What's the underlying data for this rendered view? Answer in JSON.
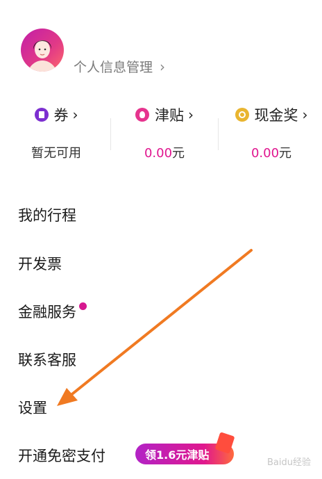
{
  "profile": {
    "link_label": "个人信息管理",
    "chevron": "›"
  },
  "wallet": [
    {
      "icon": "coupon-icon",
      "label": "券",
      "value_text": "暂无可用",
      "value_num": "",
      "value_unit": ""
    },
    {
      "icon": "allowance-icon",
      "label": "津贴",
      "value_text": "",
      "value_num": "0.00",
      "value_unit": "元"
    },
    {
      "icon": "cash-reward-icon",
      "label": "现金奖",
      "value_text": "",
      "value_num": "0.00",
      "value_unit": "元"
    }
  ],
  "menu": {
    "trips": "我的行程",
    "invoice": "开发票",
    "finance": "金融服务",
    "support": "联系客服",
    "settings": "设置",
    "password_free": "开通免密支付"
  },
  "promo": {
    "label": "领1.6元津贴"
  },
  "watermark": {
    "text": "Baidu经验"
  },
  "colors": {
    "accent": "#e0168f",
    "promo_start": "#b223c6",
    "arrow": "#f07a22"
  }
}
